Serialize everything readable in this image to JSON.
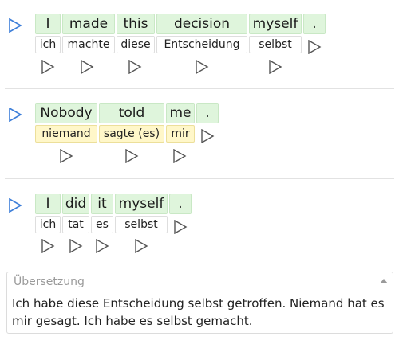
{
  "sentences": [
    {
      "words": [
        {
          "en": "I",
          "de": "ich"
        },
        {
          "en": "made",
          "de": "machte"
        },
        {
          "en": "this",
          "de": "diese"
        },
        {
          "en": "decision",
          "de": "Entscheidung"
        },
        {
          "en": "myself",
          "de": "selbst"
        },
        {
          "en": ".",
          "de": ""
        }
      ]
    },
    {
      "words": [
        {
          "en": "Nobody",
          "de": "niemand"
        },
        {
          "en": "told",
          "de": "sagte (es)"
        },
        {
          "en": "me",
          "de": "mir"
        },
        {
          "en": ".",
          "de": ""
        }
      ]
    },
    {
      "words": [
        {
          "en": "I",
          "de": "ich"
        },
        {
          "en": "did",
          "de": "tat"
        },
        {
          "en": "it",
          "de": "es"
        },
        {
          "en": "myself",
          "de": "selbst"
        },
        {
          "en": ".",
          "de": ""
        }
      ]
    }
  ],
  "translation": {
    "label": "Übersetzung",
    "text": "Ich habe diese Entscheidung selbst getroffen. Niemand hat es mir gesagt. Ich habe es selbst gemacht."
  },
  "colors": {
    "accent_blue": "#3b7dd8",
    "play_gray": "#555555",
    "english_bg": "#dff5dc",
    "highlight_bg": "#fff7c9"
  },
  "icons": {
    "sentence_play": "play-triangle-outline-blue",
    "word_play": "play-triangle-outline-gray",
    "collapse": "caret-up"
  }
}
